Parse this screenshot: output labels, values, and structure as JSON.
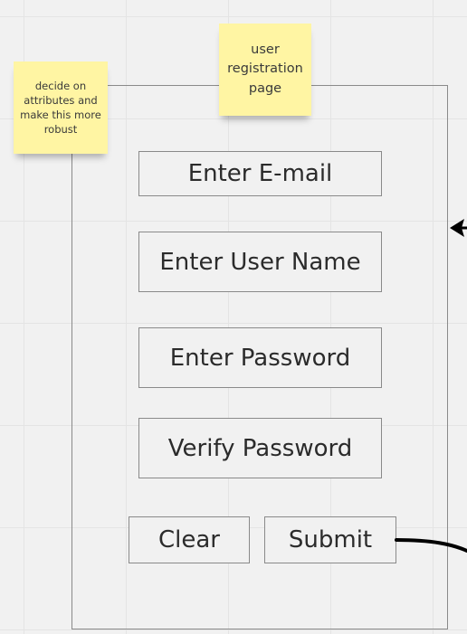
{
  "stickies": {
    "left": "decide on attributes and make this more robust",
    "top": "user registration page"
  },
  "form": {
    "email_label": "Enter E-mail",
    "username_label": "Enter User Name",
    "password_label": "Enter Password",
    "verify_label": "Verify Password",
    "clear_label": "Clear",
    "submit_label": "Submit"
  },
  "colors": {
    "sticky": "#fff5a3",
    "background": "#f1f1f1",
    "border": "#8a8a8a",
    "connector": "#000000"
  }
}
